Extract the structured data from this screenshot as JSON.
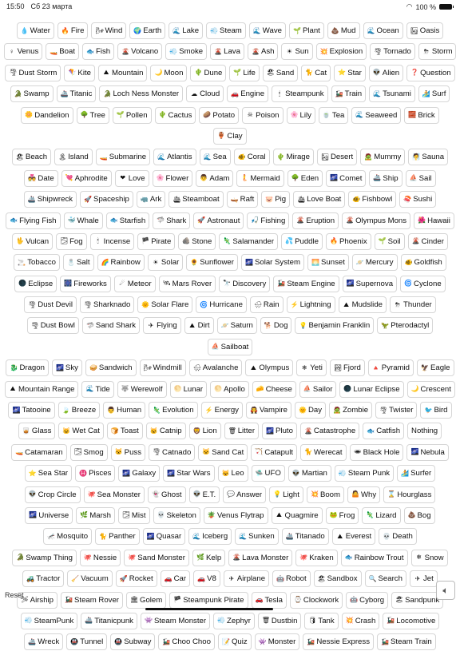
{
  "status_bar": {
    "time": "15:50",
    "date": "Сб 23 марта",
    "battery": "100 %"
  },
  "reset_label": "Reset",
  "speaker_icon": "speaker-icon",
  "rows": [
    [
      [
        "💧",
        "Water"
      ],
      [
        "🔥",
        "Fire"
      ],
      [
        "🌬",
        "Wind"
      ],
      [
        "🌍",
        "Earth"
      ],
      [
        "🌊",
        "Lake"
      ],
      [
        "💨",
        "Steam"
      ],
      [
        "🌊",
        "Wave"
      ],
      [
        "🌱",
        "Plant"
      ],
      [
        "💩",
        "Mud"
      ],
      [
        "🌊",
        "Ocean"
      ],
      [
        "🏜",
        "Oasis"
      ]
    ],
    [
      [
        "♀",
        "Venus"
      ],
      [
        "🚤",
        "Boat"
      ],
      [
        "🐟",
        "Fish"
      ],
      [
        "🌋",
        "Volcano"
      ],
      [
        "💨",
        "Smoke"
      ],
      [
        "🌋",
        "Lava"
      ],
      [
        "🌋",
        "Ash"
      ],
      [
        "☀",
        "Sun"
      ],
      [
        "💥",
        "Explosion"
      ],
      [
        "🌪",
        "Tornado"
      ],
      [
        "⛈",
        "Storm"
      ]
    ],
    [
      [
        "🌪",
        "Dust Storm"
      ],
      [
        "🪁",
        "Kite"
      ],
      [
        "⛰",
        "Mountain"
      ],
      [
        "🌙",
        "Moon"
      ],
      [
        "🌵",
        "Dune"
      ],
      [
        "🌱",
        "Life"
      ],
      [
        "🏖",
        "Sand"
      ],
      [
        "🐈",
        "Cat"
      ],
      [
        "⭐",
        "Star"
      ],
      [
        "👽",
        "Alien"
      ],
      [
        "❓",
        "Question"
      ]
    ],
    [
      [
        "🐊",
        "Swamp"
      ],
      [
        "🚢",
        "Titanic"
      ],
      [
        "🐊",
        "Loch Ness Monster"
      ],
      [
        "☁",
        "Cloud"
      ],
      [
        "🚗",
        "Engine"
      ],
      [
        "🕯",
        "Steampunk"
      ],
      [
        "🚂",
        "Train"
      ],
      [
        "🌊",
        "Tsunami"
      ],
      [
        "🏄",
        "Surf"
      ]
    ],
    [
      [
        "🌼",
        "Dandelion"
      ],
      [
        "🌳",
        "Tree"
      ],
      [
        "🌱",
        "Pollen"
      ],
      [
        "🌵",
        "Cactus"
      ],
      [
        "🥔",
        "Potato"
      ],
      [
        "☠",
        "Poison"
      ],
      [
        "🌸",
        "Lily"
      ],
      [
        "🍵",
        "Tea"
      ],
      [
        "🌊",
        "Seaweed"
      ],
      [
        "🧱",
        "Brick"
      ],
      [
        "🏺",
        "Clay"
      ]
    ],
    [
      [
        "🏖",
        "Beach"
      ],
      [
        "🏝",
        "Island"
      ],
      [
        "🚤",
        "Submarine"
      ],
      [
        "🌊",
        "Atlantis"
      ],
      [
        "🌊",
        "Sea"
      ],
      [
        "🐠",
        "Coral"
      ],
      [
        "🌵",
        "Mirage"
      ],
      [
        "🏜",
        "Desert"
      ],
      [
        "🧟",
        "Mummy"
      ],
      [
        "🧖",
        "Sauna"
      ]
    ],
    [
      [
        "💑",
        "Date"
      ],
      [
        "💘",
        "Aphrodite"
      ],
      [
        "❤",
        "Love"
      ],
      [
        "🌸",
        "Flower"
      ],
      [
        "👨",
        "Adam"
      ],
      [
        "🧜",
        "Mermaid"
      ],
      [
        "🌳",
        "Eden"
      ],
      [
        "🌌",
        "Comet"
      ],
      [
        "🚢",
        "Ship"
      ],
      [
        "⛵",
        "Sail"
      ]
    ],
    [
      [
        "🚢",
        "Shipwreck"
      ],
      [
        "🚀",
        "Spaceship"
      ],
      [
        "🦏",
        "Ark"
      ],
      [
        "🛳",
        "Steamboat"
      ],
      [
        "🛶",
        "Raft"
      ],
      [
        "🐷",
        "Pig"
      ],
      [
        "🛳",
        "Love Boat"
      ],
      [
        "🐠",
        "Fishbowl"
      ],
      [
        "🍣",
        "Sushi"
      ]
    ],
    [
      [
        "🐟",
        "Flying Fish"
      ],
      [
        "🐳",
        "Whale"
      ],
      [
        "🐟",
        "Starfish"
      ],
      [
        "🦈",
        "Shark"
      ],
      [
        "🚀",
        "Astronaut"
      ],
      [
        "🎣",
        "Fishing"
      ],
      [
        "🌋",
        "Eruption"
      ],
      [
        "🌋",
        "Olympus Mons"
      ],
      [
        "🌺",
        "Hawaii"
      ]
    ],
    [
      [
        "🖖",
        "Vulcan"
      ],
      [
        "🌫",
        "Fog"
      ],
      [
        "🕯",
        "Incense"
      ],
      [
        "🏴",
        "Pirate"
      ],
      [
        "🪨",
        "Stone"
      ],
      [
        "🦎",
        "Salamander"
      ],
      [
        "💦",
        "Puddle"
      ],
      [
        "🔥",
        "Phoenix"
      ],
      [
        "🌱",
        "Soil"
      ],
      [
        "🌋",
        "Cinder"
      ]
    ],
    [
      [
        "🚬",
        "Tobacco"
      ],
      [
        "🧂",
        "Salt"
      ],
      [
        "🌈",
        "Rainbow"
      ],
      [
        "☀",
        "Solar"
      ],
      [
        "🌻",
        "Sunflower"
      ],
      [
        "🌌",
        "Solar System"
      ],
      [
        "🌅",
        "Sunset"
      ],
      [
        "🪐",
        "Mercury"
      ],
      [
        "🐠",
        "Goldfish"
      ]
    ],
    [
      [
        "🌑",
        "Eclipse"
      ],
      [
        "🎆",
        "Fireworks"
      ],
      [
        "☄",
        "Meteor"
      ],
      [
        "🛰",
        "Mars Rover"
      ],
      [
        "🔭",
        "Discovery"
      ],
      [
        "🚂",
        "Steam Engine"
      ],
      [
        "🌌",
        "Supernova"
      ],
      [
        "🌀",
        "Cyclone"
      ]
    ],
    [
      [
        "🌪",
        "Dust Devil"
      ],
      [
        "🌪",
        "Sharknado"
      ],
      [
        "🌞",
        "Solar Flare"
      ],
      [
        "🌀",
        "Hurricane"
      ],
      [
        "🌧",
        "Rain"
      ],
      [
        "⚡",
        "Lightning"
      ],
      [
        "⛰",
        "Mudslide"
      ],
      [
        "⛈",
        "Thunder"
      ]
    ],
    [
      [
        "🌪",
        "Dust Bowl"
      ],
      [
        "🦈",
        "Sand Shark"
      ],
      [
        "✈",
        "Flying"
      ],
      [
        "⛰",
        "Dirt"
      ],
      [
        "🪐",
        "Saturn"
      ],
      [
        "🐕",
        "Dog"
      ],
      [
        "💡",
        "Benjamin Franklin"
      ],
      [
        "🦖",
        "Pterodactyl"
      ],
      [
        "⛵",
        "Sailboat"
      ]
    ],
    [
      [
        "🐉",
        "Dragon"
      ],
      [
        "🌌",
        "Sky"
      ],
      [
        "🥪",
        "Sandwich"
      ],
      [
        "🌬",
        "Windmill"
      ],
      [
        "🌨",
        "Avalanche"
      ],
      [
        "⛰",
        "Olympus"
      ],
      [
        "❄",
        "Yeti"
      ],
      [
        "🏞",
        "Fjord"
      ],
      [
        "🔺",
        "Pyramid"
      ],
      [
        "🦅",
        "Eagle"
      ]
    ],
    [
      [
        "⛰",
        "Mountain Range"
      ],
      [
        "🌊",
        "Tide"
      ],
      [
        "🐺",
        "Werewolf"
      ],
      [
        "🌕",
        "Lunar"
      ],
      [
        "🌕",
        "Apollo"
      ],
      [
        "🧀",
        "Cheese"
      ],
      [
        "⛵",
        "Sailor"
      ],
      [
        "🌑",
        "Lunar Eclipse"
      ],
      [
        "🌙",
        "Crescent"
      ]
    ],
    [
      [
        "🌌",
        "Tatooine"
      ],
      [
        "🍃",
        "Breeze"
      ],
      [
        "👨",
        "Human"
      ],
      [
        "🦎",
        "Evolution"
      ],
      [
        "⚡",
        "Energy"
      ],
      [
        "🧛",
        "Vampire"
      ],
      [
        "🌞",
        "Day"
      ],
      [
        "🧟",
        "Zombie"
      ],
      [
        "🌪",
        "Twister"
      ],
      [
        "🐦",
        "Bird"
      ]
    ],
    [
      [
        "🥃",
        "Glass"
      ],
      [
        "🐱",
        "Wet Cat"
      ],
      [
        "🍞",
        "Toast"
      ],
      [
        "🐱",
        "Catnip"
      ],
      [
        "🦁",
        "Lion"
      ],
      [
        "🗑",
        "Litter"
      ],
      [
        "🌌",
        "Pluto"
      ],
      [
        "🌋",
        "Catastrophe"
      ],
      [
        "🐟",
        "Catfish"
      ],
      [
        "",
        "Nothing"
      ]
    ],
    [
      [
        "🚤",
        "Catamaran"
      ],
      [
        "🌫",
        "Smog"
      ],
      [
        "🐱",
        "Puss"
      ],
      [
        "🌪",
        "Catnado"
      ],
      [
        "🐱",
        "Sand Cat"
      ],
      [
        "🏹",
        "Catapult"
      ],
      [
        "🐈",
        "Werecat"
      ],
      [
        "🕳",
        "Black Hole"
      ],
      [
        "🌌",
        "Nebula"
      ]
    ],
    [
      [
        "⭐",
        "Sea Star"
      ],
      [
        "♓",
        "Pisces"
      ],
      [
        "🌌",
        "Galaxy"
      ],
      [
        "🌌",
        "Star Wars"
      ],
      [
        "😺",
        "Leo"
      ],
      [
        "🛸",
        "UFO"
      ],
      [
        "👽",
        "Martian"
      ],
      [
        "💨",
        "Steam Punk"
      ],
      [
        "🏄",
        "Surfer"
      ]
    ],
    [
      [
        "👽",
        "Crop Circle"
      ],
      [
        "🐙",
        "Sea Monster"
      ],
      [
        "👻",
        "Ghost"
      ],
      [
        "👽",
        "E.T."
      ],
      [
        "💬",
        "Answer"
      ],
      [
        "💡",
        "Light"
      ],
      [
        "💥",
        "Boom"
      ],
      [
        "🤷",
        "Why"
      ],
      [
        "⌛",
        "Hourglass"
      ]
    ],
    [
      [
        "🌌",
        "Universe"
      ],
      [
        "🌿",
        "Marsh"
      ],
      [
        "🌫",
        "Mist"
      ],
      [
        "💀",
        "Skeleton"
      ],
      [
        "🪴",
        "Venus Flytrap"
      ],
      [
        "⛰",
        "Quagmire"
      ],
      [
        "🐸",
        "Frog"
      ],
      [
        "🦎",
        "Lizard"
      ],
      [
        "💩",
        "Bog"
      ]
    ],
    [
      [
        "🦟",
        "Mosquito"
      ],
      [
        "🐈",
        "Panther"
      ],
      [
        "🌌",
        "Quasar"
      ],
      [
        "🌊",
        "Iceberg"
      ],
      [
        "🌊",
        "Sunken"
      ],
      [
        "🚢",
        "Titanado"
      ],
      [
        "⛰",
        "Everest"
      ],
      [
        "💀",
        "Death"
      ]
    ],
    [
      [
        "🐊",
        "Swamp Thing"
      ],
      [
        "🐙",
        "Nessie"
      ],
      [
        "🐙",
        "Sand Monster"
      ],
      [
        "🌿",
        "Kelp"
      ],
      [
        "🌋",
        "Lava Monster"
      ],
      [
        "🐙",
        "Kraken"
      ],
      [
        "🐟",
        "Rainbow Trout"
      ],
      [
        "❄",
        "Snow"
      ]
    ],
    [
      [
        "🚜",
        "Tractor"
      ],
      [
        "🧹",
        "Vacuum"
      ],
      [
        "🚀",
        "Rocket"
      ],
      [
        "🚗",
        "Car"
      ],
      [
        "🚗",
        "V8"
      ],
      [
        "✈",
        "Airplane"
      ],
      [
        "🤖",
        "Robot"
      ],
      [
        "🏖",
        "Sandbox"
      ],
      [
        "🔍",
        "Search"
      ],
      [
        "✈",
        "Jet"
      ]
    ],
    [
      [
        "🛩",
        "Airship"
      ],
      [
        "🚂",
        "Steam Rover"
      ],
      [
        "🏛",
        "Golem"
      ],
      [
        "🏴",
        "Steampunk Pirate"
      ],
      [
        "🚗",
        "Tesla"
      ],
      [
        "⌚",
        "Clockwork"
      ],
      [
        "🤖",
        "Cyborg"
      ],
      [
        "🏖",
        "Sandpunk"
      ]
    ],
    [
      [
        "💨",
        "SteamPunk"
      ],
      [
        "🚢",
        "Titanicpunk"
      ],
      [
        "👾",
        "Steam Monster"
      ],
      [
        "💨",
        "Zephyr"
      ],
      [
        "🗑",
        "Dustbin"
      ],
      [
        "🛢",
        "Tank"
      ],
      [
        "💥",
        "Crash"
      ],
      [
        "🚂",
        "Locomotive"
      ]
    ],
    [
      [
        "🚢",
        "Wreck"
      ],
      [
        "🚇",
        "Tunnel"
      ],
      [
        "🚇",
        "Subway"
      ],
      [
        "🚂",
        "Choo Choo"
      ],
      [
        "📝",
        "Quiz"
      ],
      [
        "👾",
        "Monster"
      ],
      [
        "🚂",
        "Nessie Express"
      ],
      [
        "🚂",
        "Steam Train"
      ]
    ]
  ]
}
